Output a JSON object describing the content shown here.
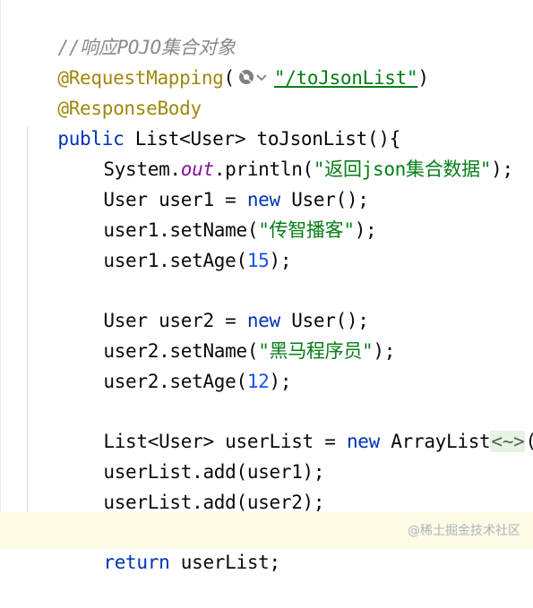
{
  "comment_text": "//响应POJO集合对象",
  "annotation_mapping": "@RequestMapping",
  "mapping_paren_open": "(",
  "mapping_url": "\"/toJsonList\"",
  "mapping_paren_close": ")",
  "annotation_body": "@ResponseBody",
  "method_kw_public": "public",
  "method_signature": " List<User> toJsonList(){",
  "line_println_a": "System.",
  "line_println_field": "out",
  "line_println_b": ".println(",
  "line_println_str": "\"返回json集合数据\"",
  "line_println_c": ");",
  "line_user1_a": "User user1 = ",
  "kw_new": "new",
  "line_user1_b": " User();",
  "line_setname1_a": "user1.setName(",
  "line_setname1_str": "\"传智播客\"",
  "line_setname1_b": ");",
  "line_setage1_a": "user1.setAge(",
  "line_setage1_num": "15",
  "line_setage1_b": ");",
  "line_user2_a": "User user2 = ",
  "line_user2_b": " User();",
  "line_setname2_a": "user2.setName(",
  "line_setname2_str": "\"黑马程序员\"",
  "line_setname2_b": ");",
  "line_setage2_a": "user2.setAge(",
  "line_setage2_num": "12",
  "line_setage2_b": ");",
  "line_list_a": "List<User> userList = ",
  "line_list_b": " ArrayList",
  "line_list_diamond": "<~>",
  "line_list_c": "();",
  "line_add1": "userList.add(user1);",
  "line_add2": "userList.add(user2);",
  "kw_return": "return",
  "line_return_b": " userList;",
  "watermark": "@稀土掘金技术社区",
  "colors": {
    "keyword": "#0033b3",
    "string": "#067d17",
    "annotation": "#9e880d",
    "number": "#1750eb",
    "comment": "#8a8a8a",
    "field": "#871094"
  },
  "icons": {
    "url_icon": "globe-dropdown-icon"
  }
}
